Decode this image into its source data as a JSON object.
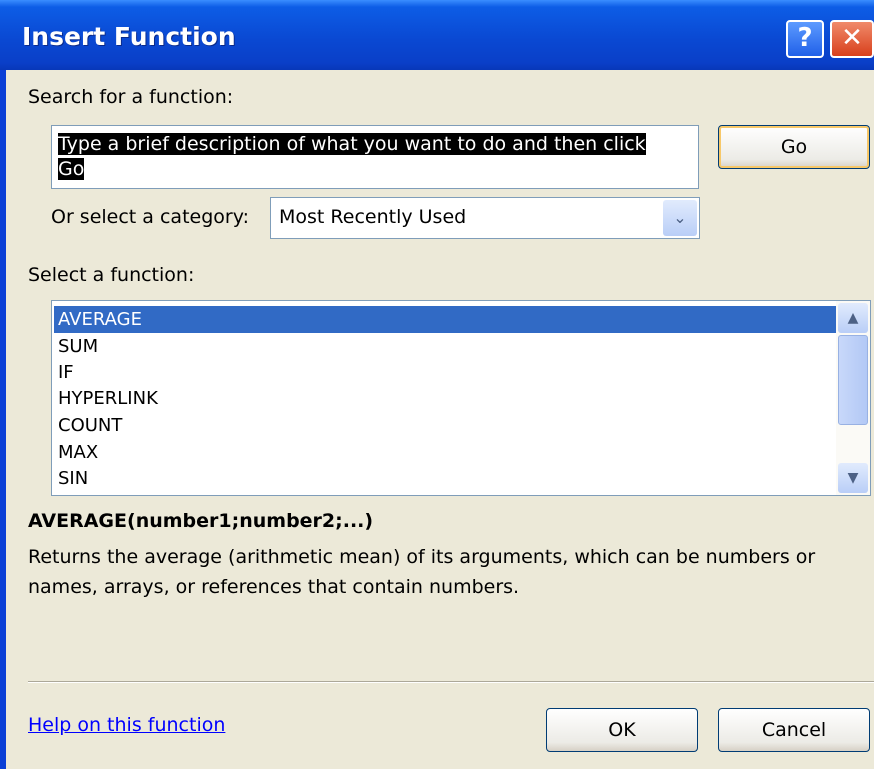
{
  "window": {
    "title": "Insert Function",
    "help_glyph": "?",
    "close_glyph": "✕"
  },
  "search": {
    "label": "Search for a function:",
    "value": "Type a brief description of what you want to do and then click Go",
    "go_label": "Go"
  },
  "category": {
    "label": "Or select a category:",
    "selected": "Most Recently Used",
    "arrow": "⌄"
  },
  "functions": {
    "label": "Select a function:",
    "items": [
      "AVERAGE",
      "SUM",
      "IF",
      "HYPERLINK",
      "COUNT",
      "MAX",
      "SIN"
    ],
    "selected": "AVERAGE",
    "scroll_up": "▲",
    "scroll_down": "▼"
  },
  "details": {
    "signature": "AVERAGE(number1;number2;...)",
    "description": "Returns the average (arithmetic mean) of its arguments, which can be numbers or names, arrays, or references that contain numbers."
  },
  "footer": {
    "help_link": "Help on this function",
    "ok_label": "OK",
    "cancel_label": "Cancel"
  },
  "colors": {
    "titlebar": "#0a49d3",
    "selection": "#316ac5",
    "dialog_bg": "#ece9d8",
    "link": "#0000ff"
  }
}
